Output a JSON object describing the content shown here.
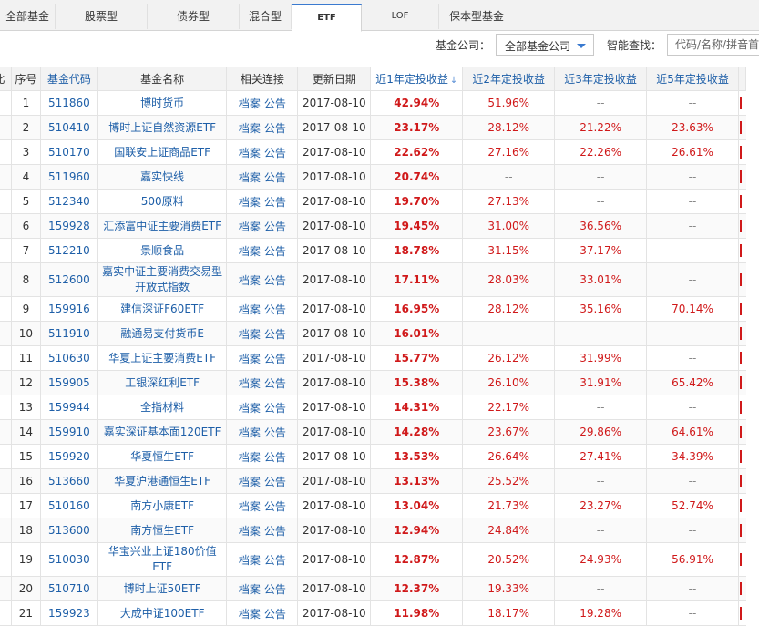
{
  "tabs": [
    {
      "label": "全部基金",
      "active": false
    },
    {
      "label": "股票型",
      "active": false
    },
    {
      "label": "债券型",
      "active": false
    },
    {
      "label": "混合型",
      "active": false
    },
    {
      "label": "ETF",
      "active": true
    },
    {
      "label": "LOF",
      "active": false
    },
    {
      "label": "保本型基金",
      "active": false
    }
  ],
  "toolbar": {
    "company_label": "基金公司：",
    "company_value": "全部基金公司",
    "search_label": "智能查找：",
    "search_placeholder": "代码/名称/拼音首字母"
  },
  "table": {
    "columns": [
      "比",
      "序号",
      "基金代码",
      "基金名称",
      "相关连接",
      "更新日期",
      "近1年定投收益",
      "近2年定投收益",
      "近3年定投收益",
      "近5年定投收益"
    ],
    "sort_icon": "↓",
    "link_archive": "档案",
    "link_notice": "公告",
    "rows": [
      {
        "idx": "1",
        "code": "511860",
        "name": "博时货币",
        "date": "2017-08-10",
        "y1": "42.94%",
        "y2": "51.96%",
        "y3": "--",
        "y5": "--"
      },
      {
        "idx": "2",
        "code": "510410",
        "name": "博时上证自然资源ETF",
        "date": "2017-08-10",
        "y1": "23.17%",
        "y2": "28.12%",
        "y3": "21.22%",
        "y5": "23.63%"
      },
      {
        "idx": "3",
        "code": "510170",
        "name": "国联安上证商品ETF",
        "date": "2017-08-10",
        "y1": "22.62%",
        "y2": "27.16%",
        "y3": "22.26%",
        "y5": "26.61%"
      },
      {
        "idx": "4",
        "code": "511960",
        "name": "嘉实快线",
        "date": "2017-08-10",
        "y1": "20.74%",
        "y2": "--",
        "y3": "--",
        "y5": "--"
      },
      {
        "idx": "5",
        "code": "512340",
        "name": "500原料",
        "date": "2017-08-10",
        "y1": "19.70%",
        "y2": "27.13%",
        "y3": "--",
        "y5": "--"
      },
      {
        "idx": "6",
        "code": "159928",
        "name": "汇添富中证主要消费ETF",
        "date": "2017-08-10",
        "y1": "19.45%",
        "y2": "31.00%",
        "y3": "36.56%",
        "y5": "--"
      },
      {
        "idx": "7",
        "code": "512210",
        "name": "景顺食品",
        "date": "2017-08-10",
        "y1": "18.78%",
        "y2": "31.15%",
        "y3": "37.17%",
        "y5": "--"
      },
      {
        "idx": "8",
        "code": "512600",
        "name": "嘉实中证主要消费交易型开放式指数",
        "date": "2017-08-10",
        "y1": "17.11%",
        "y2": "28.03%",
        "y3": "33.01%",
        "y5": "--",
        "tall": true
      },
      {
        "idx": "9",
        "code": "159916",
        "name": "建信深证F60ETF",
        "date": "2017-08-10",
        "y1": "16.95%",
        "y2": "28.12%",
        "y3": "35.16%",
        "y5": "70.14%"
      },
      {
        "idx": "10",
        "code": "511910",
        "name": "融通易支付货币E",
        "date": "2017-08-10",
        "y1": "16.01%",
        "y2": "--",
        "y3": "--",
        "y5": "--"
      },
      {
        "idx": "11",
        "code": "510630",
        "name": "华夏上证主要消费ETF",
        "date": "2017-08-10",
        "y1": "15.77%",
        "y2": "26.12%",
        "y3": "31.99%",
        "y5": "--"
      },
      {
        "idx": "12",
        "code": "159905",
        "name": "工银深红利ETF",
        "date": "2017-08-10",
        "y1": "15.38%",
        "y2": "26.10%",
        "y3": "31.91%",
        "y5": "65.42%"
      },
      {
        "idx": "13",
        "code": "159944",
        "name": "全指材料",
        "date": "2017-08-10",
        "y1": "14.31%",
        "y2": "22.17%",
        "y3": "--",
        "y5": "--"
      },
      {
        "idx": "14",
        "code": "159910",
        "name": "嘉实深证基本面120ETF",
        "date": "2017-08-10",
        "y1": "14.28%",
        "y2": "23.67%",
        "y3": "29.86%",
        "y5": "64.61%"
      },
      {
        "idx": "15",
        "code": "159920",
        "name": "华夏恒生ETF",
        "date": "2017-08-10",
        "y1": "13.53%",
        "y2": "26.64%",
        "y3": "27.41%",
        "y5": "34.39%"
      },
      {
        "idx": "16",
        "code": "513660",
        "name": "华夏沪港通恒生ETF",
        "date": "2017-08-10",
        "y1": "13.13%",
        "y2": "25.52%",
        "y3": "--",
        "y5": "--"
      },
      {
        "idx": "17",
        "code": "510160",
        "name": "南方小康ETF",
        "date": "2017-08-10",
        "y1": "13.04%",
        "y2": "21.73%",
        "y3": "23.27%",
        "y5": "52.74%"
      },
      {
        "idx": "18",
        "code": "513600",
        "name": "南方恒生ETF",
        "date": "2017-08-10",
        "y1": "12.94%",
        "y2": "24.84%",
        "y3": "--",
        "y5": "--"
      },
      {
        "idx": "19",
        "code": "510030",
        "name": "华宝兴业上证180价值ETF",
        "date": "2017-08-10",
        "y1": "12.87%",
        "y2": "20.52%",
        "y3": "24.93%",
        "y5": "56.91%",
        "tall": true
      },
      {
        "idx": "20",
        "code": "510710",
        "name": "博时上证50ETF",
        "date": "2017-08-10",
        "y1": "12.37%",
        "y2": "19.33%",
        "y3": "--",
        "y5": "--"
      },
      {
        "idx": "21",
        "code": "159923",
        "name": "大成中证100ETF",
        "date": "2017-08-10",
        "y1": "11.98%",
        "y2": "18.17%",
        "y3": "19.28%",
        "y5": "--"
      }
    ]
  }
}
